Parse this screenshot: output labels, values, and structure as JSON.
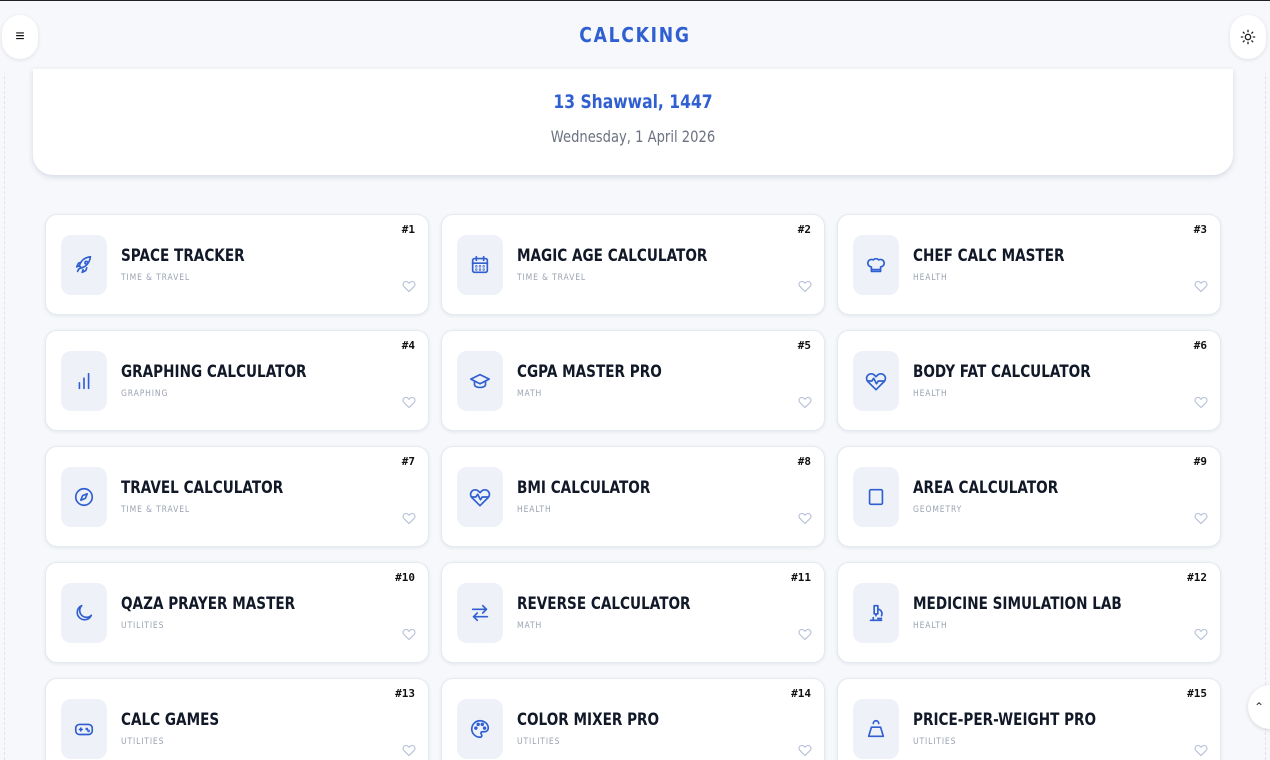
{
  "header": {
    "brand": "CALCKING",
    "menu_icon": "≡",
    "theme_icon": "sun-icon"
  },
  "date": {
    "hijri": "13 Shawwal, 1447",
    "gregorian": "Wednesday, 1 April 2026"
  },
  "scroll_top": {
    "icon": "⌃"
  },
  "calculators": [
    {
      "num": "#1",
      "title": "SPACE TRACKER",
      "category": "TIME & TRAVEL",
      "icon": "rocket"
    },
    {
      "num": "#2",
      "title": "MAGIC AGE CALCULATOR",
      "category": "TIME & TRAVEL",
      "icon": "calendar"
    },
    {
      "num": "#3",
      "title": "CHEF CALC MASTER",
      "category": "HEALTH",
      "icon": "chef-hat"
    },
    {
      "num": "#4",
      "title": "GRAPHING CALCULATOR",
      "category": "GRAPHING",
      "icon": "bar-chart"
    },
    {
      "num": "#5",
      "title": "CGPA MASTER PRO",
      "category": "MATH",
      "icon": "graduation-cap"
    },
    {
      "num": "#6",
      "title": "BODY FAT CALCULATOR",
      "category": "HEALTH",
      "icon": "heart-pulse"
    },
    {
      "num": "#7",
      "title": "TRAVEL CALCULATOR",
      "category": "TIME & TRAVEL",
      "icon": "compass"
    },
    {
      "num": "#8",
      "title": "BMI CALCULATOR",
      "category": "HEALTH",
      "icon": "heart-pulse"
    },
    {
      "num": "#9",
      "title": "AREA CALCULATOR",
      "category": "GEOMETRY",
      "icon": "square"
    },
    {
      "num": "#10",
      "title": "QAZA PRAYER MASTER",
      "category": "UTILITIES",
      "icon": "moon"
    },
    {
      "num": "#11",
      "title": "REVERSE CALCULATOR",
      "category": "MATH",
      "icon": "arrows-swap"
    },
    {
      "num": "#12",
      "title": "MEDICINE SIMULATION LAB",
      "category": "HEALTH",
      "icon": "microscope"
    },
    {
      "num": "#13",
      "title": "CALC GAMES",
      "category": "UTILITIES",
      "icon": "gamepad"
    },
    {
      "num": "#14",
      "title": "COLOR MIXER PRO",
      "category": "UTILITIES",
      "icon": "palette"
    },
    {
      "num": "#15",
      "title": "PRICE-PER-WEIGHT PRO",
      "category": "UTILITIES",
      "icon": "weight"
    }
  ],
  "colors": {
    "accent": "#2f5fd0",
    "background": "#f6f8fb",
    "icon_bg": "#eef1f8",
    "heart": "#b8c2d9"
  }
}
